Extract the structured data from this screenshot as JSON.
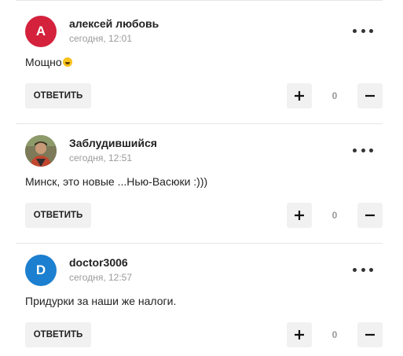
{
  "colors": {
    "avatar_red": "#d4213c",
    "avatar_blue": "#1c7fcf",
    "divider": "#e6e6e6",
    "button_bg": "#f1f1f1"
  },
  "comments": [
    {
      "avatar_letter": "А",
      "avatar_color": "#d4213c",
      "avatar_type": "letter",
      "author": "алексей любовь",
      "time": "сегодня, 12:01",
      "text": "Мощно",
      "has_emoji": true,
      "emoji_icon": "grinning-face-icon",
      "reply_label": "ОТВЕТИТЬ",
      "score": "0"
    },
    {
      "avatar_letter": "",
      "avatar_color": "#6b6a4e",
      "avatar_type": "photo",
      "author": "Заблудившийся",
      "time": "сегодня, 12:51",
      "text": "Минск, это новые ...Нью-Васюки :)))",
      "has_emoji": false,
      "reply_label": "ОТВЕТИТЬ",
      "score": "0"
    },
    {
      "avatar_letter": "D",
      "avatar_color": "#1c7fcf",
      "avatar_type": "letter",
      "author": "doctor3006",
      "time": "сегодня, 12:57",
      "text": "Придурки за наши же налоги.",
      "has_emoji": false,
      "reply_label": "ОТВЕТИТЬ",
      "score": "0"
    }
  ]
}
